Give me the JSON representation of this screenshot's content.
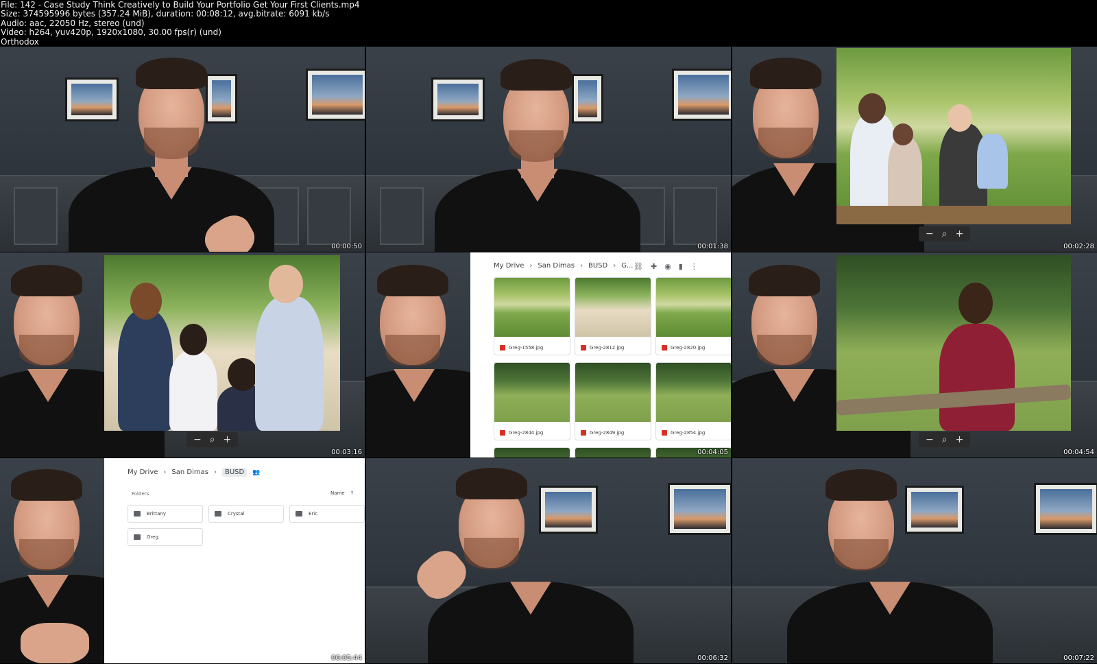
{
  "header": {
    "file": "File: 142 - Case Study Think Creatively to Build Your Portfolio Get Your First Clients.mp4",
    "size": "Size: 374595996 bytes (357.24 MiB), duration: 00:08:12, avg.bitrate: 6091 kb/s",
    "audio": "Audio: aac, 22050 Hz, stereo (und)",
    "video": "Video: h264, yuv420p, 1920x1080, 30.00 fps(r) (und)",
    "tag": "Orthodox"
  },
  "timestamps": [
    "00:00:50",
    "00:01:38",
    "00:02:28",
    "00:03:16",
    "00:04:05",
    "00:04:54",
    "00:05:44",
    "00:06:32",
    "00:07:22"
  ],
  "viewer": {
    "minus": "−",
    "zoom": "⌕",
    "plus": "+"
  },
  "drive_grid": {
    "breadcrumb": [
      "My Drive",
      "San Dimas",
      "BUSD",
      "G..."
    ],
    "files": [
      "Greg-1558.jpg",
      "Greg-2812.jpg",
      "Greg-2820.jpg",
      "Greg-2844.jpg",
      "Greg-2849.jpg",
      "Greg-2854.jpg"
    ]
  },
  "drive_folders": {
    "breadcrumb": [
      "My Drive",
      "San Dimas",
      "BUSD"
    ],
    "section": "Folders",
    "sort": "Name",
    "folders": [
      "Brittany",
      "Crystal",
      "Eric",
      "Greg"
    ]
  },
  "icons": [
    "link-icon",
    "add-person-icon",
    "eye-icon",
    "trash-icon",
    "more-vert-icon",
    "people-icon",
    "folder-icon",
    "image-file-icon",
    "sort-arrow-icon"
  ]
}
